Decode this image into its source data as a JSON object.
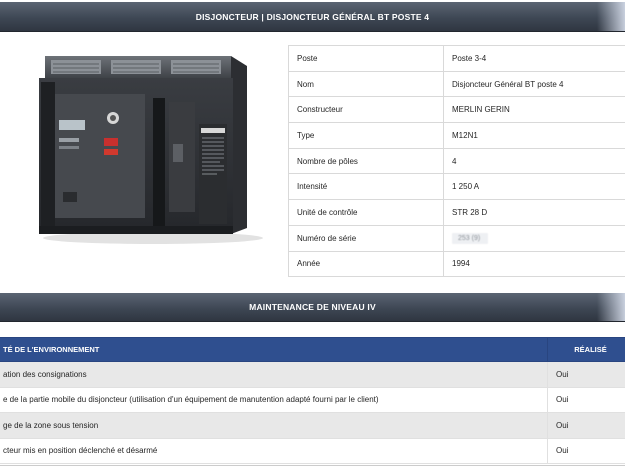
{
  "header": {
    "title": "DISJONCTEUR | DISJONCTEUR GÉNÉRAL BT POSTE 4"
  },
  "photo": {
    "alt": "disjoncteur-photo",
    "label_brand": "MERLIN GERIN"
  },
  "specs": [
    {
      "key": "Poste",
      "value": "Poste 3-4"
    },
    {
      "key": "Nom",
      "value": "Disjoncteur Général BT poste 4"
    },
    {
      "key": "Constructeur",
      "value": "MERLIN GERIN"
    },
    {
      "key": "Type",
      "value": "M12N1"
    },
    {
      "key": "Nombre de pôles",
      "value": "4"
    },
    {
      "key": "Intensité",
      "value": "1 250 A"
    },
    {
      "key": "Unité de contrôle",
      "value": "STR 28 D"
    },
    {
      "key": "Numéro de série",
      "value": "253 (9)"
    },
    {
      "key": "Année",
      "value": "1994"
    }
  ],
  "maintenance": {
    "title": "MAINTENANCE DE NIVEAU IV",
    "col_task": "TÉ DE L'ENVIRONNEMENT",
    "col_done": "RÉALISÉ",
    "rows": [
      {
        "task": "ation des consignations",
        "done": "Oui"
      },
      {
        "task": "e de la partie mobile du disjoncteur (utilisation d'un équipement de manutention adapté fourni par le client)",
        "done": "Oui"
      },
      {
        "task": "ge de la zone sous tension",
        "done": "Oui"
      },
      {
        "task": "cteur mis en position déclenché et désarmé",
        "done": "Oui"
      }
    ]
  }
}
